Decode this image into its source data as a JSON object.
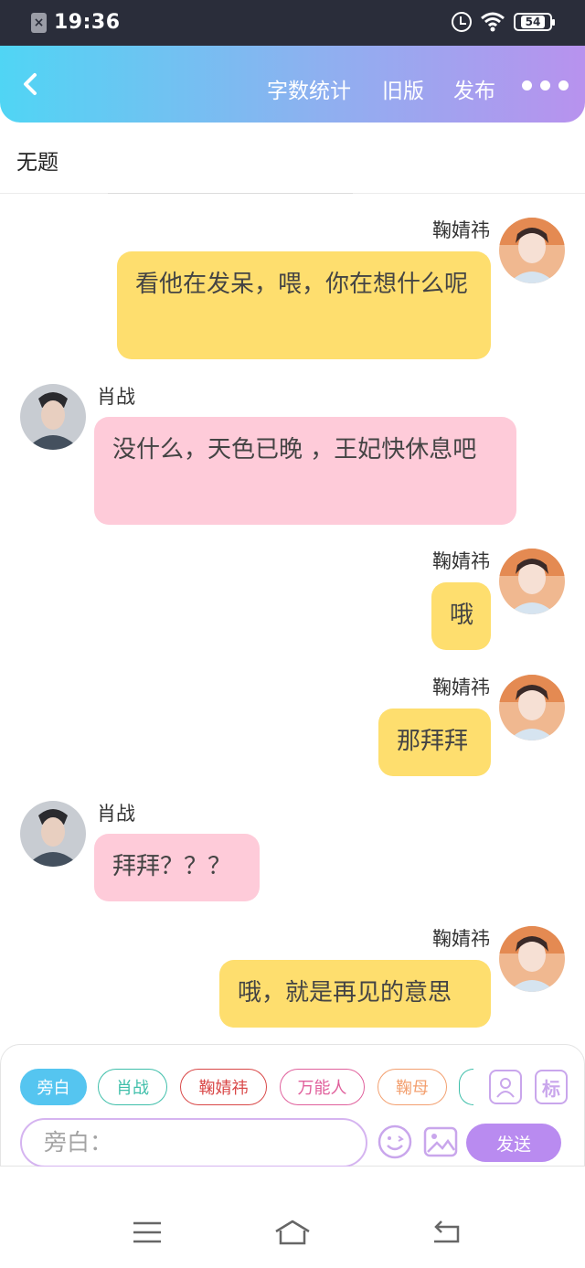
{
  "status_bar": {
    "time": "19:36",
    "battery": "54"
  },
  "header": {
    "actions": [
      "字数统计",
      "旧版",
      "发布"
    ]
  },
  "title": "无题",
  "messages": [
    {
      "speaker": "鞠婧祎",
      "side": "right",
      "text": "看他在发呆，喂，你在想什么呢"
    },
    {
      "speaker": "肖战",
      "side": "left",
      "text": "没什么，天色已晚 ，王妃快休息吧"
    },
    {
      "speaker": "鞠婧祎",
      "side": "right",
      "text": "哦"
    },
    {
      "speaker": "鞠婧祎",
      "side": "right",
      "text": "那拜拜"
    },
    {
      "speaker": "肖战",
      "side": "left",
      "text": "拜拜？？？"
    },
    {
      "speaker": "鞠婧祎",
      "side": "right",
      "text": "哦，就是再见的意思"
    }
  ],
  "composer": {
    "chips": [
      "旁白",
      "肖战",
      "鞠婧祎",
      "万能人",
      "鞠母"
    ],
    "tag_icon_label": "标",
    "input_placeholder": "旁白：",
    "send_label": "发送"
  },
  "colors": {
    "right_bubble": "#fede6e",
    "left_bubble": "#fecbd9",
    "accent": "#b98bf0"
  }
}
